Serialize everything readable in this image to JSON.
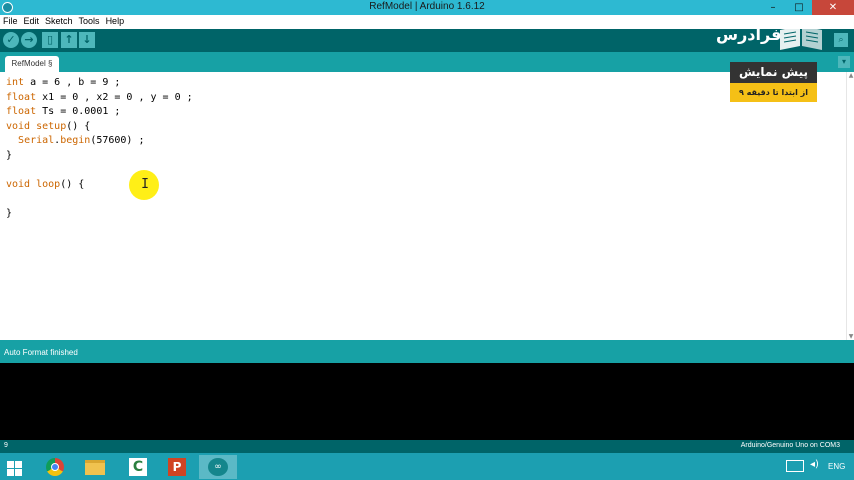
{
  "window": {
    "title": "RefModel | Arduino 1.6.12",
    "minimize": "–",
    "maximize": "□",
    "close": "✕"
  },
  "menu": [
    "File",
    "Edit",
    "Sketch",
    "Tools",
    "Help"
  ],
  "toolbar": {
    "verify": "✓",
    "upload": "→",
    "new": "▯",
    "open": "↑",
    "save": "↓",
    "serial_monitor": "⌕"
  },
  "logo": {
    "text": "فرادرس"
  },
  "tab": {
    "label": "RefModel §",
    "menu": "▾"
  },
  "code": [
    [
      {
        "t": "int",
        "c": "kw"
      },
      {
        "t": " a = 6 , b = 9 ;"
      }
    ],
    [
      {
        "t": "float",
        "c": "kw"
      },
      {
        "t": " x1 = 0 , x2 = 0 , y = 0 ;"
      }
    ],
    [
      {
        "t": "float",
        "c": "kw"
      },
      {
        "t": " Ts = 0.0001 ;"
      }
    ],
    [
      {
        "t": "void",
        "c": "kw"
      },
      {
        "t": " "
      },
      {
        "t": "setup",
        "c": "fn"
      },
      {
        "t": "() {"
      }
    ],
    [
      {
        "t": "  "
      },
      {
        "t": "Serial",
        "c": "kw"
      },
      {
        "t": "."
      },
      {
        "t": "begin",
        "c": "fn"
      },
      {
        "t": "(57600) ;"
      }
    ],
    [
      {
        "t": "}"
      }
    ],
    [
      {
        "t": ""
      }
    ],
    [
      {
        "t": "void",
        "c": "kw"
      },
      {
        "t": " "
      },
      {
        "t": "loop",
        "c": "fn"
      },
      {
        "t": "() {"
      }
    ],
    [
      {
        "t": ""
      }
    ],
    [
      {
        "t": "}"
      }
    ]
  ],
  "badge": {
    "title": "پیش نمایش",
    "subtitle": "از ابتدا تا دقیقه ۹"
  },
  "status": {
    "message": "Auto Format finished"
  },
  "footer": {
    "line_number": "9",
    "board": "Arduino/Genuino Uno on COM3"
  },
  "tray": {
    "language": "ENG"
  },
  "colors": {
    "keyword": "#cc6600",
    "toolbar": "#006468",
    "tabbar": "#17a1a5",
    "titlebar": "#2db9d2"
  }
}
